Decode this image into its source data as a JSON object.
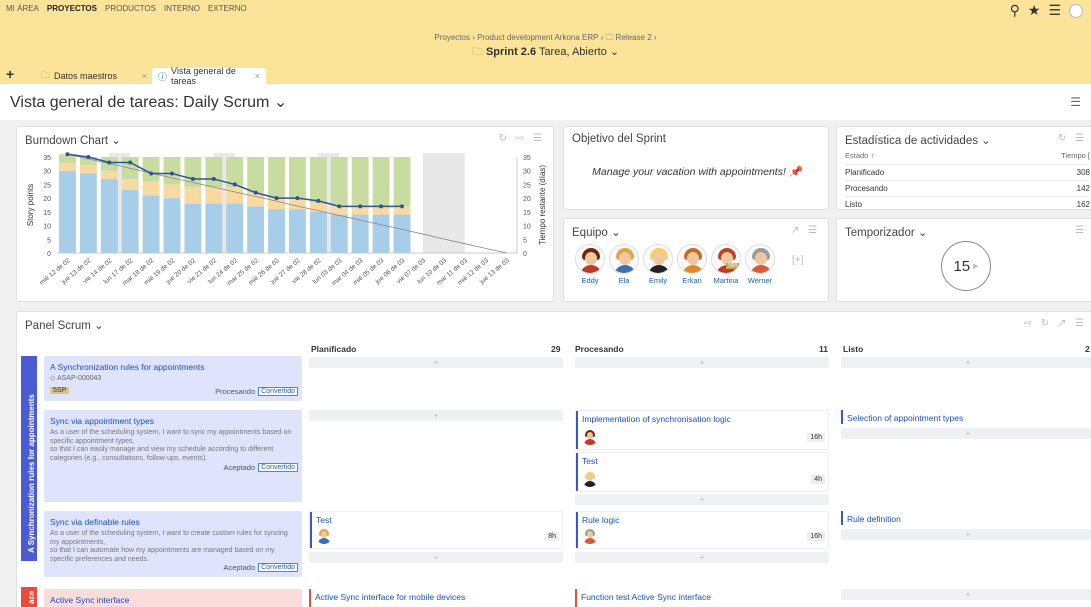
{
  "topnav": {
    "items": [
      "MI ÁREA",
      "PROYECTOS",
      "PRODUCTOS",
      "INTERNO",
      "EXTERNO"
    ],
    "active": "PROYECTOS"
  },
  "breadcrumb": "Proyectos  ›  Product development Arkona ERP  ›  🗀 Release 2  ›",
  "sprint": {
    "name": "Sprint 2.6",
    "meta": "Tarea, Abierto"
  },
  "tabs": [
    {
      "label": "Datos maestros"
    },
    {
      "label": "Vista general de tareas"
    }
  ],
  "page_title": "Vista general de tareas: Daily Scrum ⌄",
  "burndown": {
    "title": "Burndown Chart ⌄",
    "chart_data": {
      "type": "bar",
      "categories": [
        "mié 12 de 02",
        "jue 13 de 02",
        "vie 14 de 02",
        "lun 17 de 02",
        "mar 18 de 02",
        "mié 19 de 02",
        "jue 20 de 02",
        "vie 21 de 02",
        "lun 24 de 02",
        "mar 25 de 02",
        "mié 26 de 02",
        "jue 27 de 02",
        "vie 28 de 02",
        "lun 03 de 03",
        "mar 04 de 03",
        "mié 05 de 03",
        "jue 06 de 03",
        "vie 07 de 03",
        "lun 10 de 03",
        "mar 11 de 03",
        "mié 12 de 03",
        "jue 13 de 03"
      ],
      "series": [
        {
          "values": [
            30,
            29,
            27,
            23,
            21,
            20,
            18,
            18,
            18,
            17,
            16,
            16,
            15,
            14,
            14,
            14,
            14,
            0,
            0,
            0,
            0,
            0
          ]
        },
        {
          "values": [
            3,
            3,
            3,
            4,
            5,
            5,
            6,
            6,
            6,
            5,
            4,
            4,
            3,
            3,
            3,
            3,
            3,
            0,
            0,
            0,
            0,
            0
          ]
        },
        {
          "values": [
            3,
            3,
            5,
            8,
            9,
            10,
            11,
            11,
            11,
            13,
            15,
            15,
            17,
            18,
            18,
            18,
            18,
            0,
            0,
            0,
            0,
            0
          ]
        },
        {
          "values": [
            36,
            35,
            33,
            33,
            29,
            29,
            27,
            27,
            25,
            22,
            20,
            20,
            19,
            17,
            17,
            17,
            17,
            null,
            null,
            null,
            null,
            null
          ]
        },
        {
          "values": [
            36,
            34.3,
            32.6,
            30.9,
            29.1,
            27.4,
            25.7,
            24,
            22.3,
            20.6,
            18.9,
            17.1,
            15.4,
            13.7,
            12,
            10.3,
            8.6,
            6.9,
            5.1,
            3.4,
            1.7,
            0
          ]
        }
      ],
      "ylabel": "Story points",
      "y2label": "Tiempo restante (días)",
      "ylim": [
        0,
        35
      ],
      "yticks": [
        0,
        5,
        10,
        15,
        20,
        25,
        30,
        35
      ],
      "y2ticks": [
        0,
        5,
        10,
        15,
        20,
        25,
        30,
        35
      ],
      "colors": {
        "done": "#a8cde8",
        "in_progress": "#f7d9a1",
        "planned": "#c8dca2",
        "actual": "#2b5597",
        "ideal": "#888888",
        "weekend": "#e8e8e8"
      }
    }
  },
  "sprint_goal": {
    "title": "Objetivo del Sprint",
    "text": "Manage your vacation with appointments!"
  },
  "team": {
    "title": "Equipo ⌄",
    "members": [
      {
        "name": "Eddy",
        "hair": "#6b2a10",
        "shirt": "#c0392b"
      },
      {
        "name": "Ela",
        "hair": "#e0a24a",
        "shirt": "#3c6fb0"
      },
      {
        "name": "Emily",
        "hair": "#f2d16a",
        "shirt": "#222222"
      },
      {
        "name": "Erkan",
        "hair": "#c66a2a",
        "shirt": "#e08a30"
      },
      {
        "name": "Martina",
        "hair": "#b8452a",
        "shirt": "#c0392b",
        "badge": "SM"
      },
      {
        "name": "Werner",
        "hair": "#9a9a9a",
        "shirt": "#d55d3a"
      }
    ]
  },
  "stats": {
    "title": "Estadística de actividades ⌄",
    "head_left": "Estado ↑",
    "head_right": "Tiempo [",
    "rows": [
      {
        "label": "Planificado",
        "value": "308"
      },
      {
        "label": "Procesando",
        "value": "142"
      },
      {
        "label": "Listo",
        "value": "162"
      }
    ]
  },
  "timer": {
    "title": "Temporizador ⌄",
    "value": "15"
  },
  "scrum": {
    "title": "Panel Scrum ⌄",
    "columns": [
      {
        "label": "Planificado",
        "count": "29"
      },
      {
        "label": "Procesando",
        "count": "11"
      },
      {
        "label": "Listo",
        "count": "2"
      }
    ],
    "swimlane": "A Synchronization rules for appointments",
    "swimlane2": "ace",
    "stories": [
      {
        "title": "A Synchronization rules for appointments",
        "sub": "◇ ASAP-000043",
        "points": "5SP",
        "status": "Procesando",
        "conv": "Convertido"
      },
      {
        "title": "Sync via appointment types",
        "desc": "As a user of the scheduling system, I want to sync my appointments based on specific appointment types,\nso that I can easily manage and view my schedule according to different categories (e.g., consultations, follow-ups, events).",
        "status": "Aceptado",
        "conv": "Convertido"
      },
      {
        "title": "Sync via definable rules",
        "desc": "As a user of the scheduling system, I want to create custom rules for syncing my appointments,\nso that I can automate how my appointments are managed based on my specific preferences and needs.",
        "status": "Aceptado",
        "conv": "Convertido"
      },
      {
        "title": "Active Sync interface"
      }
    ],
    "tasks": {
      "t1": {
        "title": "Implementation of synchronisation logic",
        "hours": "16h"
      },
      "t2": {
        "title": "Test",
        "hours": "4h"
      },
      "t3": {
        "title": "Selection of appointment types"
      },
      "t4": {
        "title": "Test",
        "hours": "8h"
      },
      "t5": {
        "title": "Rule logic",
        "hours": "16h"
      },
      "t6": {
        "title": "Rule definition"
      },
      "t7": {
        "title": "Active Sync interface for mobile devices"
      },
      "t8": {
        "title": "Function test Active Sync interface"
      }
    },
    "add": "+"
  }
}
